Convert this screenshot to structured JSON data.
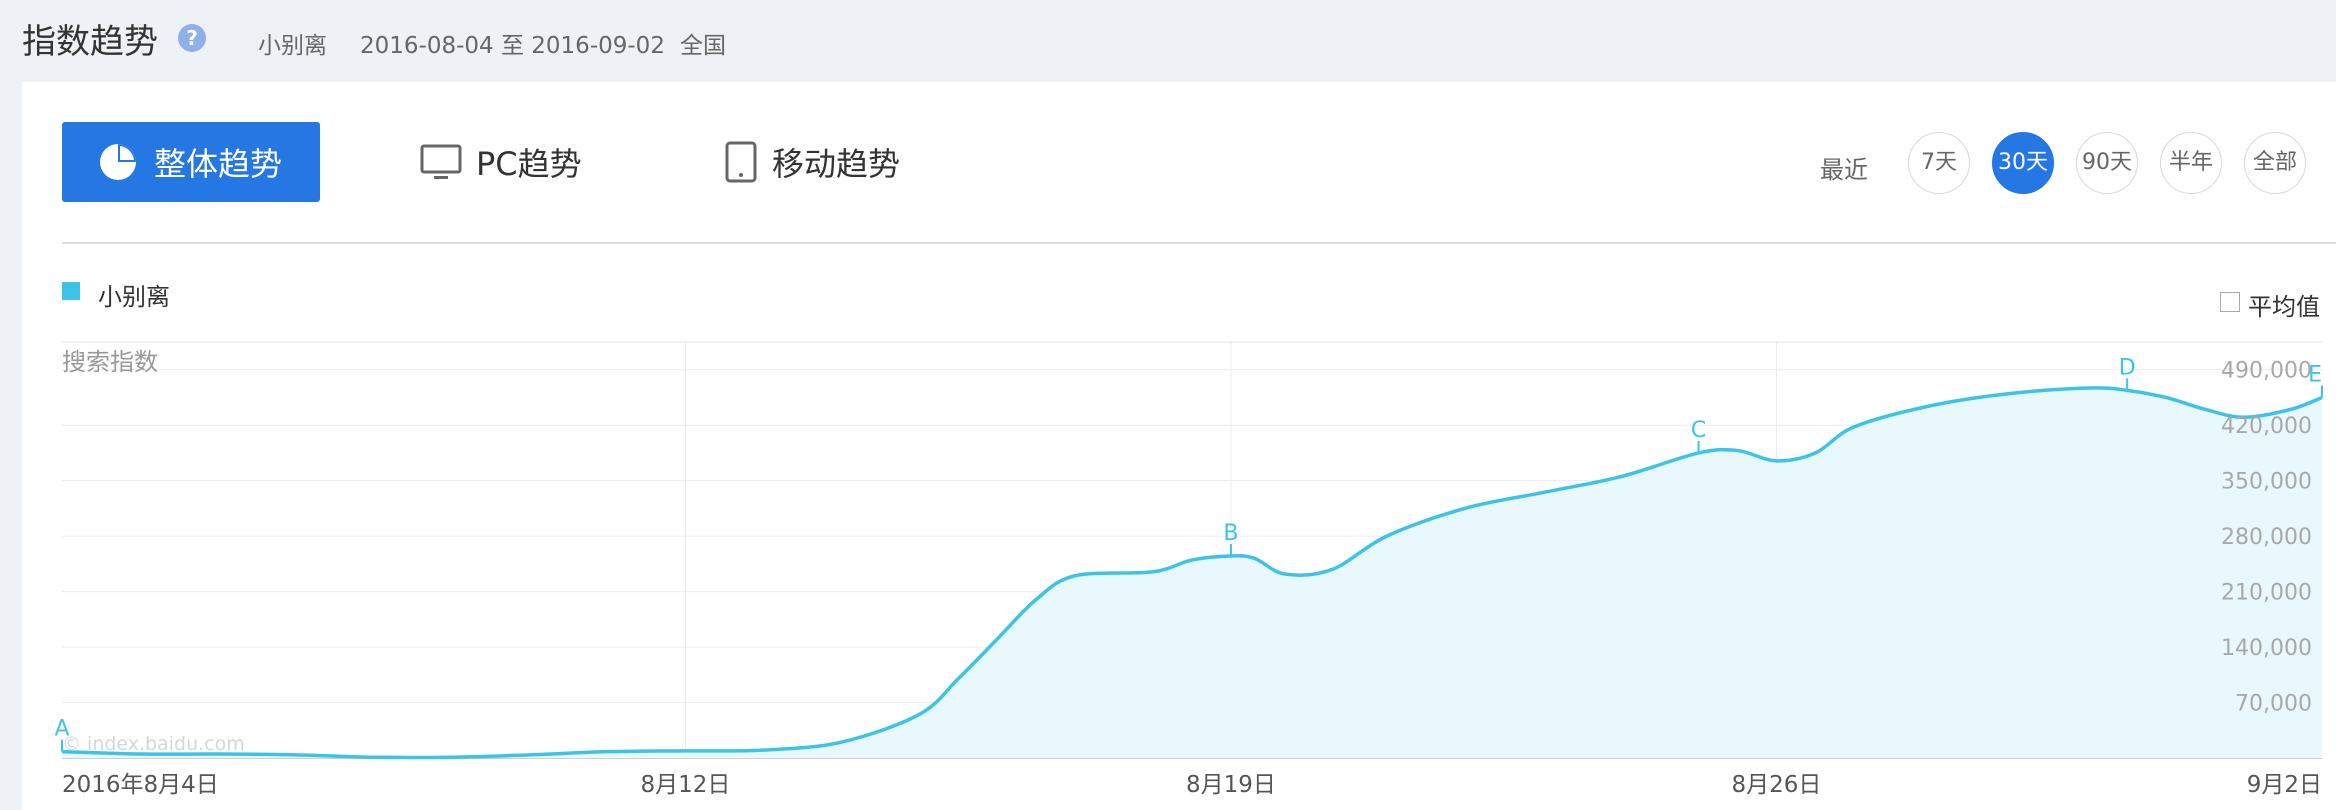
{
  "header": {
    "title": "指数趋势",
    "help_glyph": "?",
    "keyword": "小别离",
    "date_range": "2016-08-04 至 2016-09-02",
    "region": "全国"
  },
  "tabs": {
    "overall": "整体趋势",
    "pc": "PC趋势",
    "mobile": "移动趋势"
  },
  "range": {
    "label": "最近",
    "options": [
      "7天",
      "30天",
      "90天",
      "半年",
      "全部"
    ],
    "selected": "30天"
  },
  "legend": {
    "series_name": "小别离",
    "average_toggle": "平均值"
  },
  "colors": {
    "accent": "#2577e3",
    "series": "#3ec3e8",
    "area": "#e9f8fc"
  },
  "chart_data": {
    "type": "area",
    "ylabel": "搜索指数",
    "watermark": "© index.baidu.com",
    "ylim": [
      0,
      525000
    ],
    "y_ticks": [
      70000,
      140000,
      210000,
      280000,
      350000,
      420000,
      490000
    ],
    "y_tick_labels": [
      "70,000",
      "140,000",
      "210,000",
      "280,000",
      "350,000",
      "420,000",
      "490,000"
    ],
    "x_tick_labels": [
      {
        "day": 0,
        "label": "2016年8月4日"
      },
      {
        "day": 8,
        "label": "8月12日"
      },
      {
        "day": 15,
        "label": "8月19日"
      },
      {
        "day": 22,
        "label": "8月26日"
      },
      {
        "day": 29,
        "label": "9月2日"
      }
    ],
    "x_days": 29,
    "series": [
      {
        "name": "小别离",
        "points": [
          [
            0,
            8000
          ],
          [
            1,
            5000
          ],
          [
            2,
            5000
          ],
          [
            3,
            4000
          ],
          [
            4,
            1000
          ],
          [
            5,
            1000
          ],
          [
            6,
            4000
          ],
          [
            7,
            8000
          ],
          [
            8,
            9000
          ],
          [
            9,
            10000
          ],
          [
            10,
            20000
          ],
          [
            11,
            55000
          ],
          [
            11.5,
            100000
          ],
          [
            12,
            150000
          ],
          [
            12.5,
            200000
          ],
          [
            13,
            230000
          ],
          [
            14,
            235000
          ],
          [
            14.5,
            250000
          ],
          [
            15,
            255000
          ],
          [
            15.3,
            252000
          ],
          [
            15.7,
            232000
          ],
          [
            16.3,
            238000
          ],
          [
            17,
            280000
          ],
          [
            18,
            315000
          ],
          [
            19,
            335000
          ],
          [
            20,
            355000
          ],
          [
            21,
            385000
          ],
          [
            21.5,
            388000
          ],
          [
            22,
            375000
          ],
          [
            22.5,
            385000
          ],
          [
            23,
            418000
          ],
          [
            24,
            445000
          ],
          [
            25,
            460000
          ],
          [
            26,
            467000
          ],
          [
            26.5,
            464000
          ],
          [
            27,
            455000
          ],
          [
            27.5,
            440000
          ],
          [
            28,
            430000
          ],
          [
            28.6,
            440000
          ],
          [
            29,
            455000
          ]
        ]
      }
    ],
    "annotations": [
      {
        "label": "A",
        "day": 0,
        "value": 8000
      },
      {
        "label": "B",
        "day": 15,
        "value": 255000
      },
      {
        "label": "C",
        "day": 21,
        "value": 385000
      },
      {
        "label": "D",
        "day": 26.5,
        "value": 464000
      },
      {
        "label": "E",
        "day": 29,
        "value": 455000
      }
    ]
  }
}
